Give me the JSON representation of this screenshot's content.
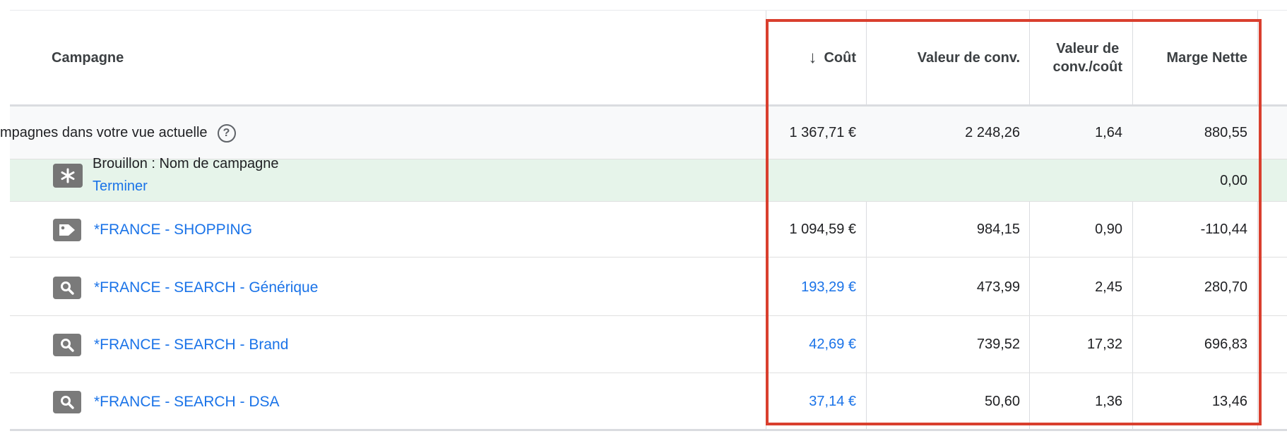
{
  "header": {
    "campaign": "Campagne",
    "cost_arrow": "↓",
    "cost": "Coût",
    "conv_value": "Valeur de conv.",
    "conv_value_cost_line1": "Valeur de",
    "conv_value_cost_line2": "conv./coût",
    "net_margin": "Marge Nette"
  },
  "total": {
    "label": "mpagnes dans votre vue actuelle",
    "help": "?",
    "cost": "1 367,71 €",
    "conv_value": "2 248,26",
    "ratio": "1,64",
    "margin": "880,55"
  },
  "draft": {
    "title": "Brouillon : Nom de campagne",
    "link": "Terminer",
    "margin": "0,00"
  },
  "rows": [
    {
      "icon": "tag-icon",
      "name": "*FRANCE - SHOPPING",
      "cost": "1 094,59 €",
      "cost_link": false,
      "conv_value": "984,15",
      "ratio": "0,90",
      "margin": "-110,44"
    },
    {
      "icon": "search-icon",
      "name": "*FRANCE - SEARCH - Générique",
      "cost": "193,29 €",
      "cost_link": true,
      "conv_value": "473,99",
      "ratio": "2,45",
      "margin": "280,70"
    },
    {
      "icon": "search-icon",
      "name": "*FRANCE - SEARCH - Brand",
      "cost": "42,69 €",
      "cost_link": true,
      "conv_value": "739,52",
      "ratio": "17,32",
      "margin": "696,83"
    },
    {
      "icon": "search-icon",
      "name": "*FRANCE - SEARCH - DSA",
      "cost": "37,14 €",
      "cost_link": true,
      "conv_value": "50,60",
      "ratio": "1,36",
      "margin": "13,46"
    }
  ],
  "colors": {
    "highlight": "#d93f2e",
    "link": "#1a73e8",
    "draft_bg": "#e6f4ea"
  }
}
